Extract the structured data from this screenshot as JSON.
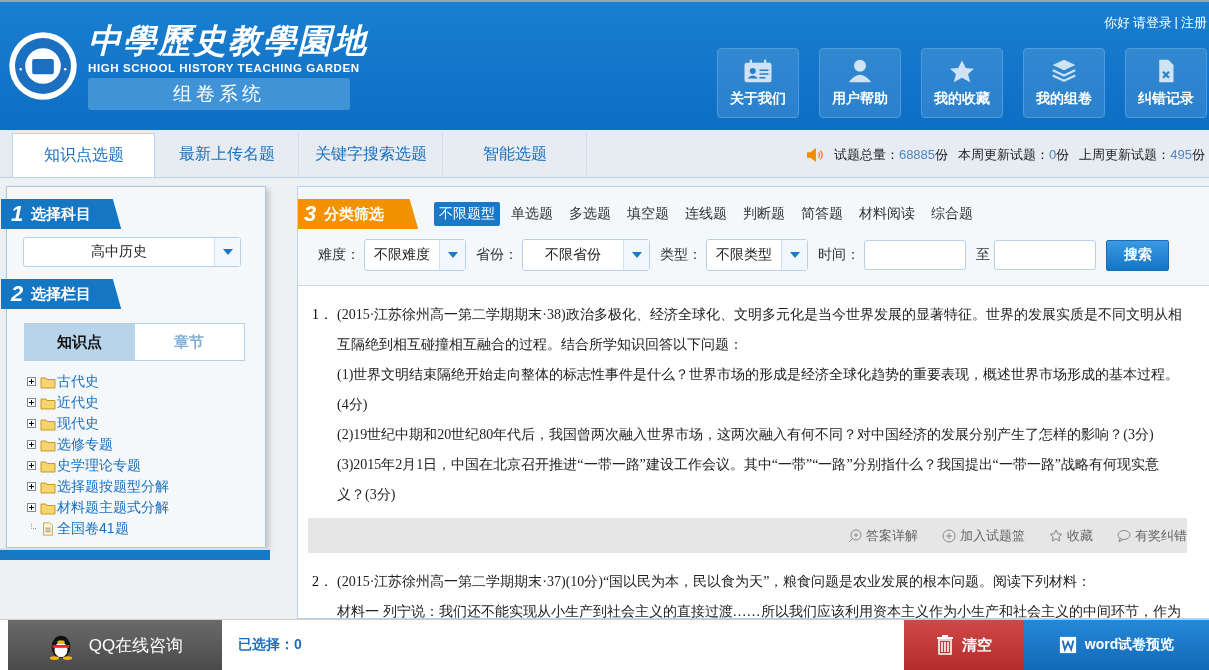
{
  "header": {
    "logo_title": "中學歷史教學園地",
    "logo_subtitle": "HIGH SCHOOL HISTORY TEACHING GARDEN",
    "system_label": "组卷系统",
    "user_links": {
      "greeting": "你好",
      "login": "请登录",
      "separator": "|",
      "register": "注册"
    },
    "nav_buttons": [
      {
        "label": "关于我们",
        "kind": "card"
      },
      {
        "label": "用户帮助",
        "kind": "user"
      },
      {
        "label": "我的收藏",
        "kind": "star"
      },
      {
        "label": "我的组卷",
        "kind": "layers"
      },
      {
        "label": "纠错记录",
        "kind": "file-x"
      }
    ]
  },
  "tabs": [
    {
      "label": "知识点选题",
      "selected": true
    },
    {
      "label": "最新上传名题",
      "selected": false
    },
    {
      "label": "关键字搜索选题",
      "selected": false
    },
    {
      "label": "智能选题",
      "selected": false
    }
  ],
  "stats": [
    {
      "label": "试题总量：",
      "value": "68885",
      "unit": "份"
    },
    {
      "label": "本周更新试题：",
      "value": "0",
      "unit": "份"
    },
    {
      "label": "上周更新试题：",
      "value": "495",
      "unit": "份"
    }
  ],
  "sidebar": {
    "step1": {
      "number": "1",
      "title": "选择科目"
    },
    "subject": "高中历史",
    "step2": {
      "number": "2",
      "title": "选择栏目"
    },
    "segments": [
      {
        "label": "知识点",
        "selected": true
      },
      {
        "label": "章节",
        "selected": false
      }
    ],
    "tree": [
      {
        "label": "古代史",
        "kind": "folder",
        "expanded": false
      },
      {
        "label": "近代史",
        "kind": "folder",
        "expanded": false
      },
      {
        "label": "现代史",
        "kind": "folder",
        "expanded": false
      },
      {
        "label": "选修专题",
        "kind": "folder",
        "expanded": false
      },
      {
        "label": "史学理论专题",
        "kind": "folder",
        "expanded": false
      },
      {
        "label": "选择题按题型分解",
        "kind": "folder",
        "expanded": false
      },
      {
        "label": "材料题主题式分解",
        "kind": "folder",
        "expanded": false
      },
      {
        "label": "全国卷41题",
        "kind": "file"
      }
    ]
  },
  "filter": {
    "step3": {
      "number": "3",
      "title": "分类筛选"
    },
    "types": [
      {
        "label": "不限题型",
        "selected": true
      },
      {
        "label": "单选题",
        "selected": false
      },
      {
        "label": "多选题",
        "selected": false
      },
      {
        "label": "填空题",
        "selected": false
      },
      {
        "label": "连线题",
        "selected": false
      },
      {
        "label": "判断题",
        "selected": false
      },
      {
        "label": "简答题",
        "selected": false
      },
      {
        "label": "材料阅读",
        "selected": false
      },
      {
        "label": "综合题",
        "selected": false
      }
    ],
    "selects": [
      {
        "label": "难度：",
        "value": "不限难度"
      },
      {
        "label": "省份：",
        "value": "不限省份"
      },
      {
        "label": "类型：",
        "value": "不限类型"
      }
    ],
    "time_label": "时间：",
    "range_separator": "至",
    "search_button": "搜索"
  },
  "questions": [
    {
      "number": "1．",
      "lines": [
        "(2015·江苏徐州高一第二学期期末·38)政治多极化、经济全球化、文明多元化是当今世界发展的显著特征。世界的发展实质是不同文明从相互隔绝到相互碰撞相互融合的过程。结合所学知识回答以下问题：",
        "(1)世界文明结束隔绝开始走向整体的标志性事件是什么？世界市场的形成是经济全球化趋势的重要表现，概述世界市场形成的基本过程。(4分)",
        "(2)19世纪中期和20世纪80年代后，我国曾两次融入世界市场，这两次融入有何不同？对中国经济的发展分别产生了怎样的影响？(3分)",
        "(3)2015年2月1日，中国在北京召开推进“一带一路”建设工作会议。其中“一带”“一路”分别指什么？我国提出“一带一路”战略有何现实意义？(3分)"
      ],
      "actions": [
        {
          "label": "答案详解",
          "kind": "zoom"
        },
        {
          "label": "加入试题篮",
          "kind": "plus"
        },
        {
          "label": "收藏",
          "kind": "star"
        },
        {
          "label": "有奖纠错",
          "kind": "comment"
        }
      ]
    },
    {
      "number": "2．",
      "lines": [
        "(2015·江苏徐州高一第二学期期末·37)(10分)“国以民为本，民以食为天”，粮食问题是农业发展的根本问题。阅读下列材料：",
        "材料一 列宁说：我们还不能实现从小生产到社会主义的直接过渡……所以我们应该利用资本主义作为小生产和社会主义的中间环节，作为"
      ]
    }
  ],
  "bottom_bar": {
    "qq": "QQ在线咨询",
    "selected_label": "已选择：",
    "selected_count": "0",
    "clear": "清空",
    "preview": "word试卷预览"
  }
}
